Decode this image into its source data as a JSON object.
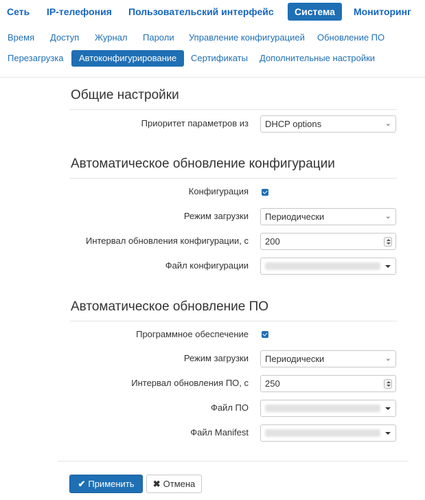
{
  "topnav": [
    {
      "label": "Сеть"
    },
    {
      "label": "IP-телефония"
    },
    {
      "label": "Пользовательский интерфейс"
    },
    {
      "label": "Система",
      "active": true
    },
    {
      "label": "Мониторинг"
    }
  ],
  "subnav_row1": [
    "Время",
    "Доступ",
    "Журнал",
    "Пароли",
    "Управление конфигурацией",
    "Обновление ПО"
  ],
  "subnav_row2": [
    "Перезагрузка",
    "Автоконфигурирование",
    "Сертификаты",
    "Дополнительные настройки"
  ],
  "general": {
    "title": "Общие настройки",
    "priority_label": "Приоритет параметров из",
    "priority_value": "DHCP options"
  },
  "config_update": {
    "title": "Автоматическое обновление конфигурации",
    "config_label": "Конфигурация",
    "config_checked": true,
    "mode_label": "Режим загрузки",
    "mode_value": "Периодически",
    "interval_label": "Интервал обновления конфигурации, с",
    "interval_value": "200",
    "file_label": "Файл конфигурации"
  },
  "fw_update": {
    "title": "Автоматическое обновление ПО",
    "fw_label": "Программное обеспечение",
    "fw_checked": true,
    "mode_label": "Режим загрузки",
    "mode_value": "Периодически",
    "interval_label": "Интервал обновления ПО, с",
    "interval_value": "250",
    "file_label": "Файл ПО",
    "manifest_label": "Файл Manifest"
  },
  "buttons": {
    "apply": "Применить",
    "apply_icon": "✔",
    "cancel": "Отмена",
    "cancel_icon": "✖"
  },
  "colors": {
    "accent": "#1f6fb5",
    "link": "#1565c0"
  }
}
